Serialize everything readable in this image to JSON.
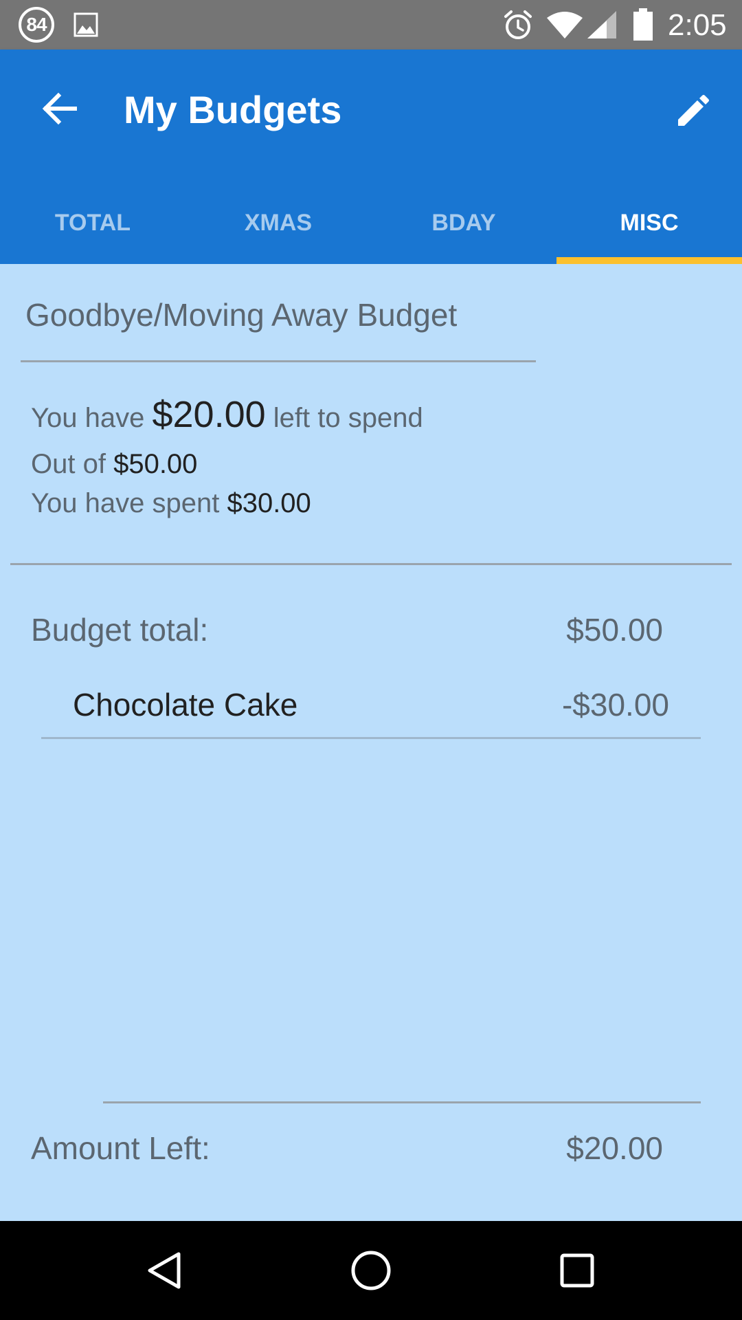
{
  "status_bar": {
    "notification_count": "84",
    "time": "2:05",
    "icons": [
      "image-icon",
      "alarm-icon",
      "wifi-icon",
      "cell-signal-icon",
      "battery-icon"
    ]
  },
  "app_bar": {
    "title": "My Budgets",
    "back_icon": "arrow-back-icon",
    "edit_icon": "pencil-icon",
    "color": "#1976d2",
    "tabs": [
      {
        "label": "TOTAL",
        "active": false
      },
      {
        "label": "XMAS",
        "active": false
      },
      {
        "label": "BDAY",
        "active": false
      },
      {
        "label": "MISC",
        "active": true
      }
    ],
    "indicator_color": "#fbc02d"
  },
  "budget": {
    "name": "Goodbye/Moving Away Budget",
    "summary": {
      "left_prefix": "You have",
      "left_amount": "$20.00",
      "left_suffix": "left to spend",
      "outof_prefix": "Out of",
      "outof_amount": "$50.00",
      "spent_prefix": "You have spent",
      "spent_amount": "$30.00"
    },
    "total_label": "Budget total:",
    "total_value": "$50.00",
    "expenses": [
      {
        "name": "Chocolate Cake",
        "amount": "-$30.00"
      }
    ],
    "left_label": "Amount Left:",
    "left_value": "$20.00"
  },
  "nav_bar": {
    "buttons": [
      "nav-back-icon",
      "nav-home-icon",
      "nav-recents-icon"
    ]
  },
  "colors": {
    "content_background": "#bbdefb",
    "status_bar": "#757575"
  }
}
